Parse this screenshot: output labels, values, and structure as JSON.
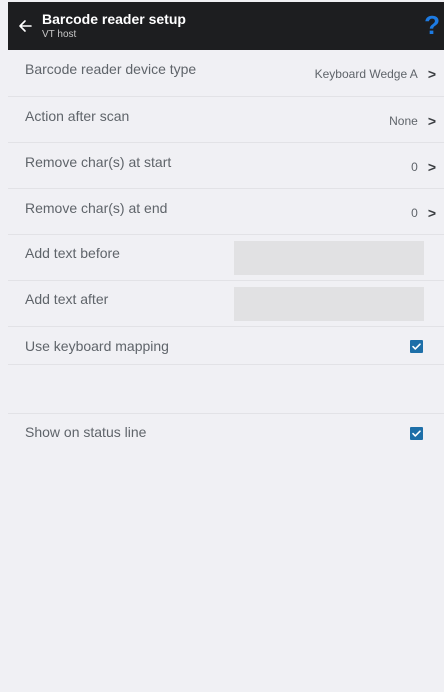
{
  "app_bar": {
    "title": "Barcode reader setup",
    "subtitle": "VT host",
    "back_icon": "arrow-left-icon",
    "help_icon": "question-mark-icon",
    "help_glyph": "?"
  },
  "settings": {
    "device_type": {
      "label": "Barcode reader device type",
      "value": "Keyboard Wedge A"
    },
    "action_after_scan": {
      "label": "Action after scan",
      "value": "None"
    },
    "remove_start": {
      "label": "Remove char(s) at start",
      "value": "0"
    },
    "remove_end": {
      "label": "Remove char(s) at end",
      "value": "0"
    },
    "add_text_before": {
      "label": "Add text before",
      "value": ""
    },
    "add_text_after": {
      "label": "Add text after",
      "value": ""
    },
    "keyboard_mapping": {
      "label": "Use keyboard mapping",
      "checked": true
    },
    "status_line": {
      "label": "Show on status line",
      "checked": true
    }
  },
  "chevron_glyph": ">",
  "colors": {
    "app_bar_bg": "#1d1e20",
    "help_accent": "#1d7be3",
    "checkbox": "#1e6fa8",
    "background": "#f0f0f4"
  }
}
